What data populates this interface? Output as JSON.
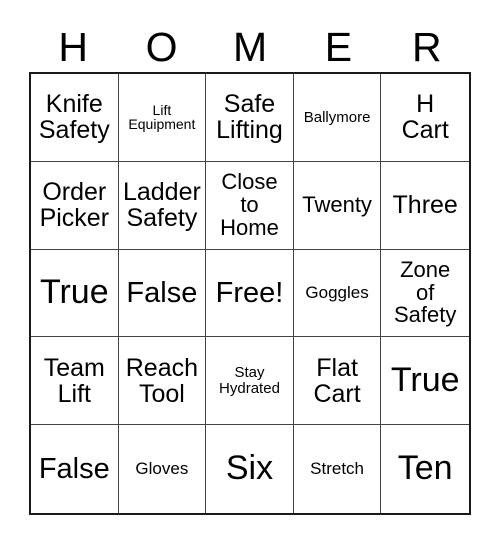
{
  "card": {
    "title_letters": [
      "H",
      "O",
      "M",
      "E",
      "R"
    ],
    "background_color": "#ffffff",
    "text_color": "#000000",
    "border_color": "#1a1a1a",
    "grid_line_color": "#444444",
    "rows": 5,
    "columns": 5
  },
  "cells": [
    {
      "text": "Knife\nSafety",
      "size": "fs-md"
    },
    {
      "text": "Lift\nEquipment",
      "size": "fs-tiny"
    },
    {
      "text": "Safe\nLifting",
      "size": "fs-md"
    },
    {
      "text": "Ballymore",
      "size": "fs-xxs"
    },
    {
      "text": "H\nCart",
      "size": "fs-md"
    },
    {
      "text": "Order\nPicker",
      "size": "fs-md"
    },
    {
      "text": "Ladder\nSafety",
      "size": "fs-md"
    },
    {
      "text": "Close\nto\nHome",
      "size": "fs-sm"
    },
    {
      "text": "Twenty",
      "size": "fs-sm"
    },
    {
      "text": "Three",
      "size": "fs-md"
    },
    {
      "text": "True",
      "size": "fs-xl"
    },
    {
      "text": "False",
      "size": "fs-lg"
    },
    {
      "text": "Free!",
      "size": "fs-lg"
    },
    {
      "text": "Goggles",
      "size": "fs-xs"
    },
    {
      "text": "Zone\nof\nSafety",
      "size": "fs-sm"
    },
    {
      "text": "Team\nLift",
      "size": "fs-md"
    },
    {
      "text": "Reach\nTool",
      "size": "fs-md"
    },
    {
      "text": "Stay\nHydrated",
      "size": "fs-xxs"
    },
    {
      "text": "Flat\nCart",
      "size": "fs-md"
    },
    {
      "text": "True",
      "size": "fs-xl"
    },
    {
      "text": "False",
      "size": "fs-lg"
    },
    {
      "text": "Gloves",
      "size": "fs-xs"
    },
    {
      "text": "Six",
      "size": "fs-xl"
    },
    {
      "text": "Stretch",
      "size": "fs-xs"
    },
    {
      "text": "Ten",
      "size": "fs-xl"
    }
  ]
}
